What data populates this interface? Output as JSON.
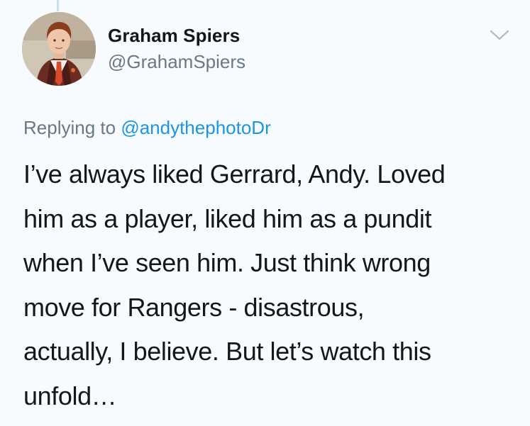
{
  "author": {
    "name": "Graham Spiers",
    "handle": "@GrahamSpiers",
    "avatar_icon": "profile-photo-avatar"
  },
  "menu": {
    "icon": "chevron-down-icon"
  },
  "reply": {
    "prefix": "Replying to",
    "mention": "@andythephotoDr"
  },
  "tweet": {
    "lines": [
      "I’ve always liked Gerrard, Andy. Loved",
      "him as a player, liked him as a pundit",
      "when I’ve seen him. Just think wrong",
      "move for Rangers - disastrous,",
      "actually, I believe. But let’s watch this",
      "unfold…"
    ]
  },
  "colors": {
    "background": "#f8fbfd",
    "text": "#14171a",
    "secondary": "#687985",
    "link": "#1b95e0",
    "thread_line": "#c9dce8"
  }
}
